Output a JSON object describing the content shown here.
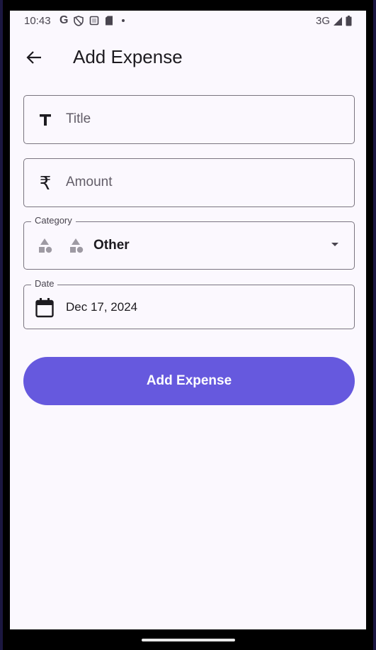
{
  "status_bar": {
    "time": "10:43",
    "network": "3G",
    "left_icons": [
      "google-icon",
      "shield-icon",
      "screenshot-icon",
      "sim-card-icon",
      "dot-icon"
    ],
    "right_icons": [
      "signal-icon",
      "battery-icon"
    ]
  },
  "app_bar": {
    "title": "Add Expense",
    "back_icon": "arrow-back-icon"
  },
  "form": {
    "title_field": {
      "placeholder": "Title",
      "value": "",
      "icon": "title-text-icon"
    },
    "amount_field": {
      "placeholder": "Amount",
      "value": "",
      "icon": "rupee-icon",
      "icon_glyph": "₹"
    },
    "category_field": {
      "label": "Category",
      "value": "Other",
      "icon": "category-shapes-icon"
    },
    "date_field": {
      "label": "Date",
      "value": "Dec 17, 2024",
      "icon": "calendar-icon"
    },
    "submit_label": "Add Expense"
  },
  "colors": {
    "primary": "#6659de",
    "background": "#fbf8fe",
    "outline": "#7a7580",
    "text": "#1d1b20"
  }
}
